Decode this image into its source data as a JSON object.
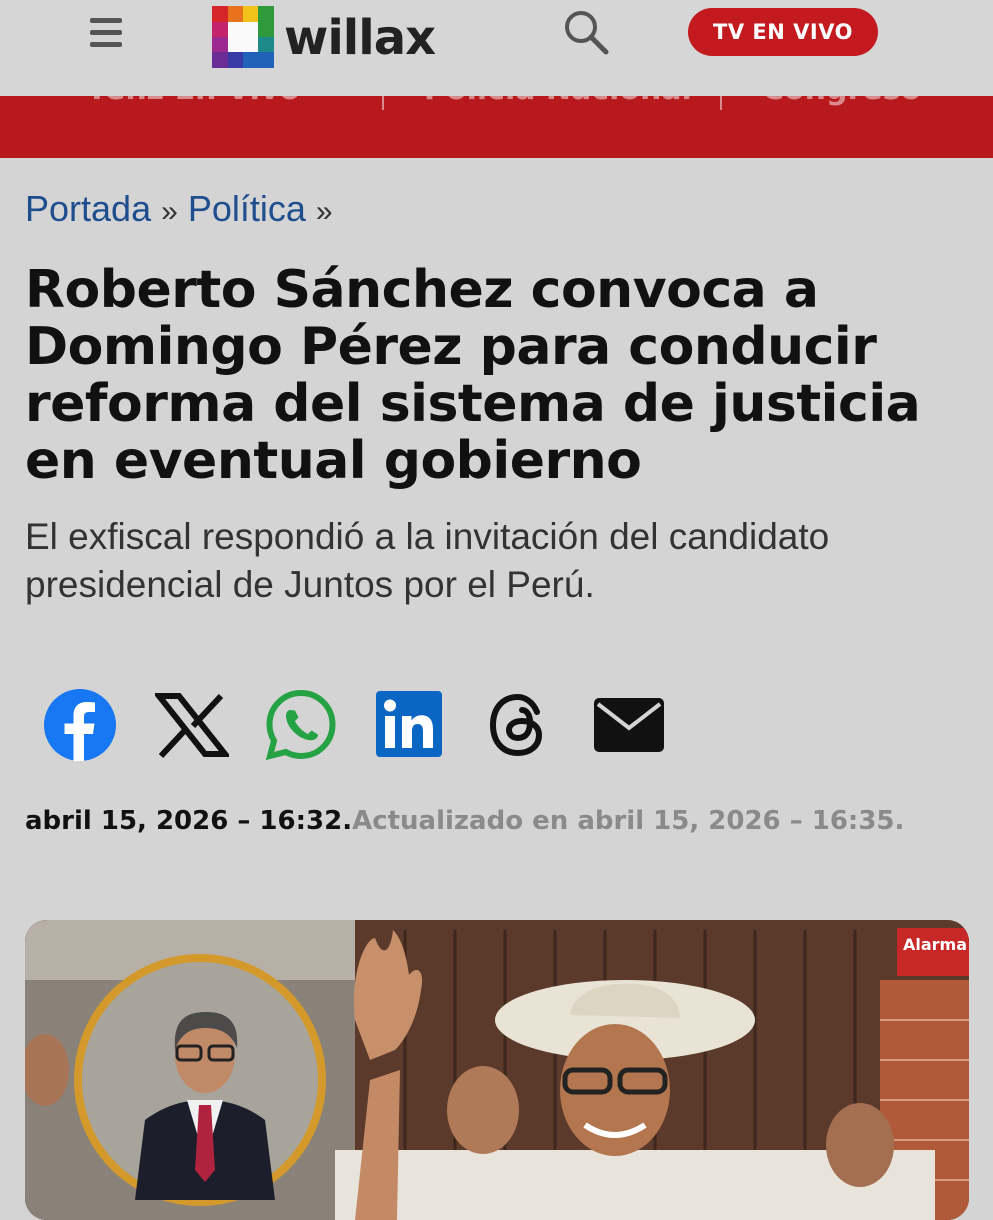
{
  "header": {
    "brand": "willax",
    "tv_button": "TV EN VIVO",
    "icons": [
      "menu-icon",
      "willax-logo-mark",
      "search-icon"
    ]
  },
  "nav": {
    "items": [
      "Yenz En Vivo",
      "Policía Nacional",
      "Congreso"
    ]
  },
  "breadcrumb": {
    "home": "Portada",
    "section": "Política",
    "separator": "»"
  },
  "article": {
    "title": "Roberto Sánchez convoca a Domingo Pérez para conducir reforma del sistema de justicia en eventual gobierno",
    "subtitle": "El exfiscal respondió a la invitación del candidato presidencial de Juntos por el Perú.",
    "published": "abril 15, 2026 – 16:32.",
    "updated": "Actualizado en abril 15, 2026 – 16:35."
  },
  "share": {
    "icons": [
      "facebook-icon",
      "x-icon",
      "whatsapp-icon",
      "linkedin-icon",
      "threads-icon",
      "email-icon"
    ]
  },
  "photo": {
    "sign_text": "Alarma"
  },
  "colors": {
    "brand_red": "#c21a1f",
    "nav_red": "#b8191d",
    "link_blue": "#1f4e8f",
    "facebook": "#1877f2",
    "whatsapp": "#25a244",
    "linkedin": "#0a66c2"
  }
}
